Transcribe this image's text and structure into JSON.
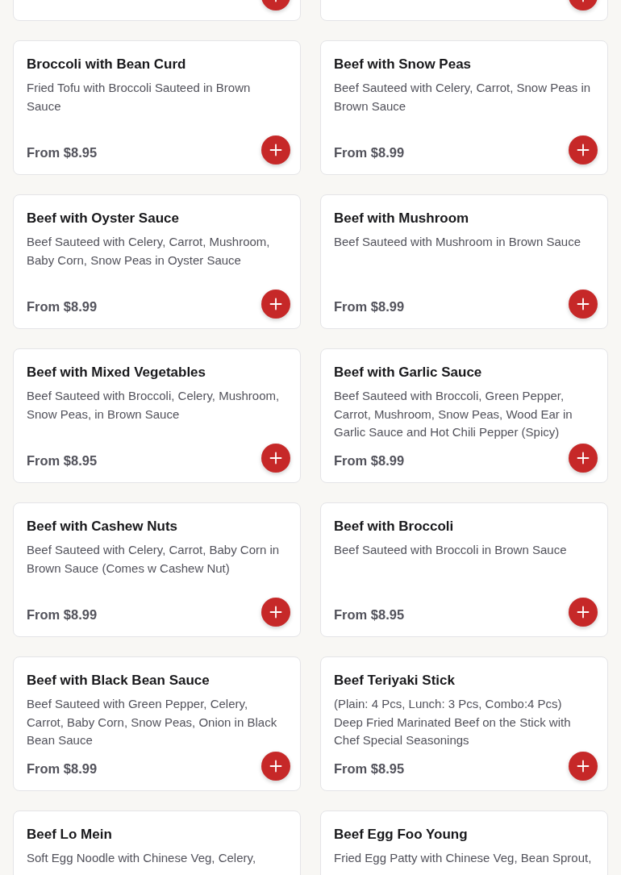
{
  "items": [
    {
      "kind": "cut"
    },
    {
      "kind": "cut"
    },
    {
      "kind": "dish",
      "name": "Broccoli with Bean Curd",
      "description": "Fried Tofu with Broccoli Sauteed in Brown Sauce",
      "price": "From $8.95"
    },
    {
      "kind": "dish",
      "name": "Beef with Snow Peas",
      "description": "Beef Sauteed with Celery, Carrot, Snow Peas in Brown Sauce",
      "price": "From $8.99"
    },
    {
      "kind": "dish",
      "name": "Beef with Oyster Sauce",
      "description": "Beef Sauteed with Celery, Carrot, Mushroom, Baby Corn, Snow Peas in Oyster Sauce",
      "price": "From $8.99"
    },
    {
      "kind": "dish",
      "name": "Beef with Mushroom",
      "description": "Beef Sauteed with Mushroom in Brown Sauce",
      "price": "From $8.99"
    },
    {
      "kind": "dish",
      "name": "Beef with Mixed Vegetables",
      "description": "Beef Sauteed with Broccoli, Celery, Mushroom, Snow Peas, in Brown Sauce",
      "price": "From $8.95"
    },
    {
      "kind": "dish",
      "name": "Beef with Garlic Sauce",
      "description": "Beef Sauteed with Broccoli, Green Pepper, Carrot, Mushroom, Snow Peas, Wood Ear in Garlic Sauce and Hot Chili Pepper (Spicy)",
      "price": "From $8.99"
    },
    {
      "kind": "dish",
      "name": "Beef with Cashew Nuts",
      "description": "Beef Sauteed with Celery, Carrot, Baby Corn in Brown Sauce (Comes w Cashew Nut)",
      "price": "From $8.99"
    },
    {
      "kind": "dish",
      "name": "Beef with Broccoli",
      "description": "Beef Sauteed with Broccoli in Brown Sauce",
      "price": "From $8.95"
    },
    {
      "kind": "dish",
      "name": "Beef with Black Bean Sauce",
      "description": "Beef Sauteed with Green Pepper, Celery, Carrot, Baby Corn, Snow Peas, Onion in Black Bean Sauce",
      "price": "From $8.99"
    },
    {
      "kind": "dish",
      "name": "Beef Teriyaki Stick",
      "description": "(Plain: 4 Pcs, Lunch: 3 Pcs, Combo:4 Pcs) Deep Fried Marinated Beef on the Stick with Chef Special Seasonings",
      "price": "From $8.95"
    },
    {
      "kind": "dish",
      "name": "Beef Lo Mein",
      "description": "Soft Egg Noodle with Chinese Veg, Celery,"
    },
    {
      "kind": "dish",
      "name": "Beef Egg Foo Young",
      "description": "Fried Egg Patty with Chinese Veg, Bean Sprout,"
    }
  ]
}
